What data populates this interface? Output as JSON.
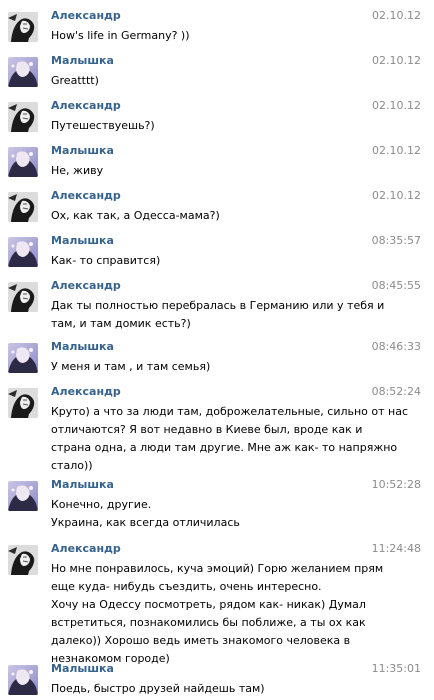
{
  "messages": [
    {
      "author": "Александр",
      "avatar": "avatar-aleksandr",
      "time": "02.10.12",
      "lines": [
        "How's life in Germany? ))"
      ]
    },
    {
      "author": "Малышка",
      "avatar": "avatar-malyshka",
      "time": "02.10.12",
      "lines": [
        "Greatttt)"
      ]
    },
    {
      "author": "Александр",
      "avatar": "avatar-aleksandr",
      "time": "02.10.12",
      "lines": [
        "Путешествуешь?)"
      ]
    },
    {
      "author": "Малышка",
      "avatar": "avatar-malyshka",
      "time": "02.10.12",
      "lines": [
        "Не, живу"
      ]
    },
    {
      "author": "Александр",
      "avatar": "avatar-aleksandr",
      "time": "02.10.12",
      "lines": [
        "Ох, как так, а Одесса-мама?)"
      ]
    },
    {
      "author": "Малышка",
      "avatar": "avatar-malyshka",
      "time": "08:35:57",
      "lines": [
        "Как- то справится)"
      ]
    },
    {
      "author": "Александр",
      "avatar": "avatar-aleksandr",
      "time": "08:45:55",
      "lines": [
        "Дак ты полностью перебралась в Германию или у тебя и",
        "там, и там домик есть?)"
      ]
    },
    {
      "author": "Малышка",
      "avatar": "avatar-malyshka",
      "time": "08:46:33",
      "lines": [
        "У меня и там , и там семья)"
      ]
    },
    {
      "author": "Александр",
      "avatar": "avatar-aleksandr",
      "time": "08:52:24",
      "lines": [
        "Круто) а что за люди там, доброжелательные, сильно от нас",
        "отличаются? Я вот недавно в Киеве был, вроде как и",
        "страна одна, а люди там другие. Мне аж как- то напряжно",
        "стало))"
      ]
    },
    {
      "author": "Малышка",
      "avatar": "avatar-malyshka",
      "time": "10:52:28",
      "lines": [
        "Конечно, другие.",
        "Украина, как всегда отличилась"
      ]
    },
    {
      "author": "Александр",
      "avatar": "avatar-aleksandr",
      "time": "11:24:48",
      "lines": [
        "Но мне понравилось, куча эмоций) Горю желанием прям",
        "еще куда- нибудь съездить, очень интересно.",
        "Хочу на Одессу посмотреть, рядом как- никак) Думал",
        "встретиться, познакомились бы поближе, а ты ох как",
        "далеко)) Хорошо ведь иметь знакомого человека в",
        "незнакомом городе)"
      ]
    },
    {
      "author": "Малышка",
      "avatar": "avatar-malyshka",
      "time": "11:35:01",
      "lines": [
        "Поедь, быстро друзей найдешь там)"
      ]
    }
  ]
}
